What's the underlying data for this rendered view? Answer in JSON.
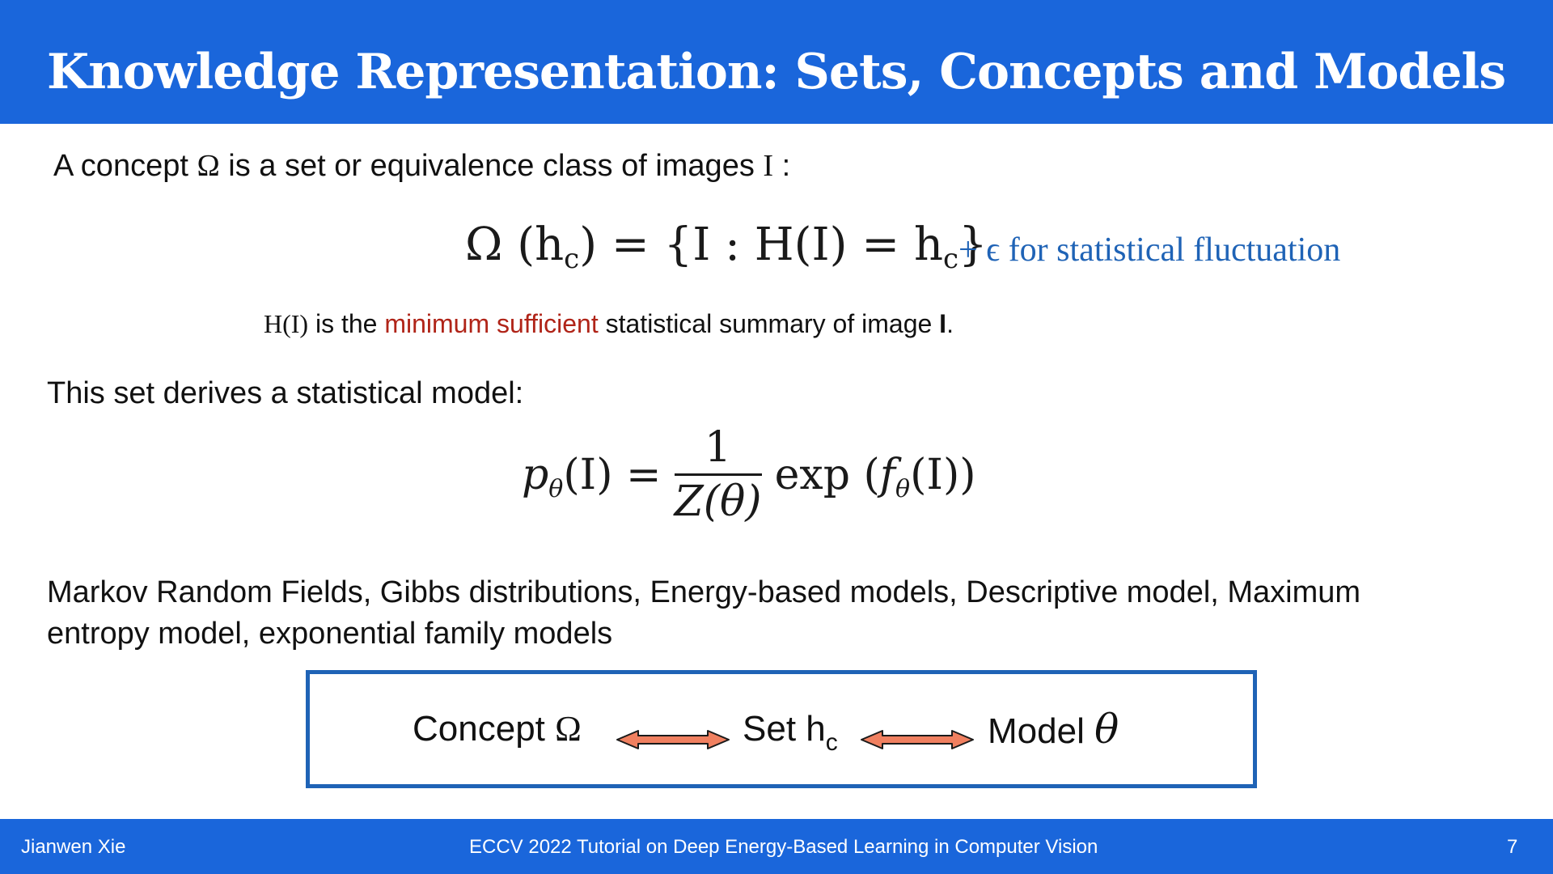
{
  "slide": {
    "title": "Knowledge Representation: Sets, Concepts and Models"
  },
  "intro": {
    "prefix": "A concept ",
    "omega": "Ω",
    "middle": " is a set or equivalence class of images ",
    "image_var": "I",
    "suffix": " :"
  },
  "equation1": {
    "text": "Ω (h",
    "sub": "c",
    "middle": ") = {I : H(I) = h",
    "sub2": "c",
    "end": "}",
    "note": "+ ϵ for statistical fluctuation"
  },
  "summary": {
    "hvar": "H(I)",
    "pre": " is the ",
    "highlight": "minimum sufficient",
    "post": " statistical summary of image ",
    "image_bold": "I",
    "period": "."
  },
  "model_intro": "This set derives a statistical model:",
  "equation2": {
    "p": "p",
    "p_sub": "θ",
    "lhs_arg": "(I) =",
    "numerator": "1",
    "denominator": "Z(θ)",
    "rhs_exp": "exp (",
    "f": "f",
    "f_sub": "θ",
    "rhs_arg": "(I))"
  },
  "models_list": "Markov Random Fields, Gibbs distributions, Energy-based models, Descriptive model, Maximum entropy model, exponential family models",
  "equivalence_box": {
    "concept_label": "Concept ",
    "concept_symbol": "Ω",
    "set_label": "Set h",
    "set_sub": "c",
    "model_label": "Model ",
    "model_symbol": "θ",
    "arrow_color": "#f08060"
  },
  "footer": {
    "author": "Jianwen Xie",
    "event": "ECCV 2022 Tutorial on Deep Energy-Based Learning in Computer Vision",
    "page": "7"
  },
  "colors": {
    "header_bg": "#1a66db",
    "accent_blue": "#1f63b6",
    "highlight_red": "#b02418"
  }
}
